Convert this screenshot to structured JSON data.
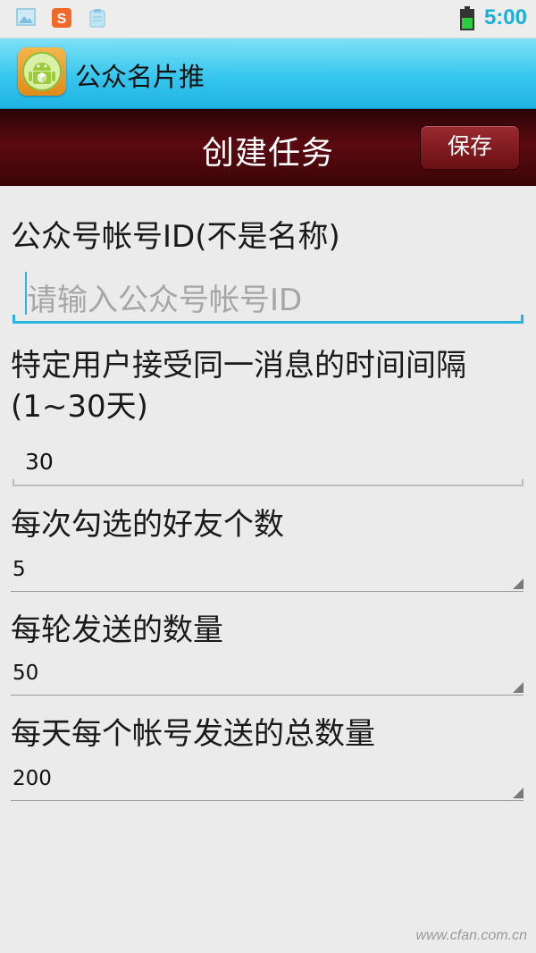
{
  "status_bar": {
    "time": "5:00",
    "icons": [
      "image-icon",
      "sogou-icon",
      "clipboard-icon",
      "battery-icon"
    ]
  },
  "app_bar": {
    "title": "公众名片推"
  },
  "title_bar": {
    "title": "创建任务",
    "save_label": "保存"
  },
  "form": {
    "account_label": "公众号帐号ID(不是名称)",
    "account_placeholder": "请输入公众号帐号ID",
    "interval_label": "特定用户接受同一消息的时间间隔(1~30天)",
    "interval_value": "30",
    "friends_label": "每次勾选的好友个数",
    "friends_value": "5",
    "per_round_label": "每轮发送的数量",
    "per_round_value": "50",
    "daily_total_label": "每天每个帐号发送的总数量",
    "daily_total_value": "200"
  },
  "watermark": "www.cfan.com.cn",
  "colors": {
    "accent": "#27b4df",
    "title_bar": "#5a0a10",
    "app_bar": "#36c6ee",
    "background": "#ebebeb"
  }
}
